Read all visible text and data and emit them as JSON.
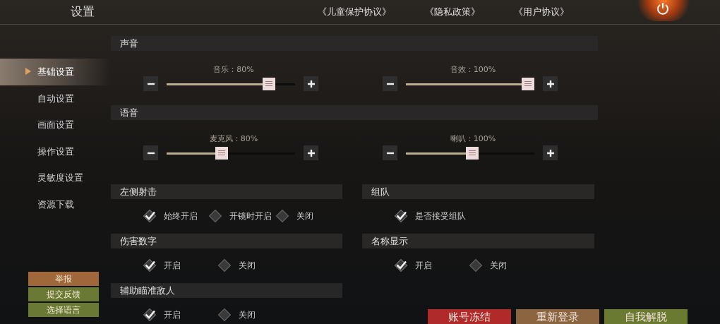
{
  "title": "设置",
  "links": [
    "《儿童保护协议》",
    "《隐私政策》",
    "《用户协议》"
  ],
  "sidebar": {
    "items": [
      {
        "label": "基础设置",
        "selected": true
      },
      {
        "label": "自动设置",
        "selected": false
      },
      {
        "label": "画面设置",
        "selected": false
      },
      {
        "label": "操作设置",
        "selected": false
      },
      {
        "label": "灵敏度设置",
        "selected": false
      },
      {
        "label": "资源下载",
        "selected": false
      }
    ],
    "buttons": [
      {
        "label": "举报",
        "color": "#a0683a"
      },
      {
        "label": "提交反馈",
        "color": "#6a7a35"
      },
      {
        "label": "选择语言",
        "color": "#6a7a35"
      }
    ]
  },
  "audio_sections": [
    {
      "title": "声音",
      "sliders": [
        {
          "label": "音乐：80%",
          "level": 0.83
        },
        {
          "label": "音效：100%",
          "level": 1
        }
      ]
    },
    {
      "title": "语音",
      "sliders": [
        {
          "label": "麦克风：80%",
          "level": 0.42
        },
        {
          "label": "喇叭：100%",
          "level": 0.52
        }
      ]
    }
  ],
  "option_groups": [
    {
      "title": "左侧射击",
      "options": [
        {
          "label": "始终开启",
          "checked": true
        },
        {
          "label": "开镜时开启",
          "checked": false
        },
        {
          "label": "关闭",
          "checked": false
        }
      ]
    },
    {
      "title": "组队",
      "options": [
        {
          "label": "是否接受组队",
          "checked": true
        }
      ]
    },
    {
      "title": "伤害数字",
      "options": [
        {
          "label": "开启",
          "checked": true
        },
        {
          "label": "关闭",
          "checked": false
        }
      ]
    },
    {
      "title": "名称显示",
      "options": [
        {
          "label": "开启",
          "checked": true
        },
        {
          "label": "关闭",
          "checked": false
        }
      ]
    },
    {
      "title": "辅助瞄准敌人",
      "options": [
        {
          "label": "开启",
          "checked": true
        },
        {
          "label": "关闭",
          "checked": false
        }
      ]
    }
  ],
  "actions": [
    {
      "label": "账号冻结",
      "color": "#b02a2a"
    },
    {
      "label": "重新登录",
      "color": "#8a6540"
    },
    {
      "label": "自我解脱",
      "color": "#6a7a30"
    }
  ]
}
